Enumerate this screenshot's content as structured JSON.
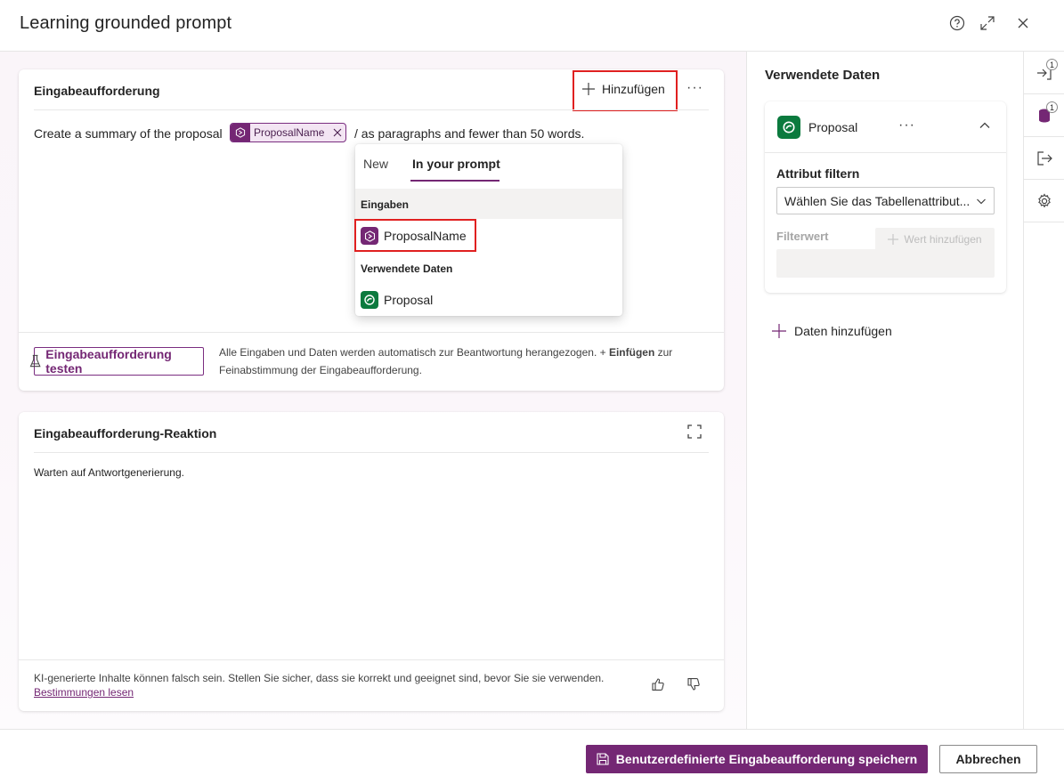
{
  "dialog": {
    "title": "Learning grounded prompt"
  },
  "prompt_card": {
    "title": "Eingabeaufforderung",
    "add_label": "Hinzufügen",
    "text_before": "Create a summary of the proposal",
    "chip_label": "ProposalName",
    "text_after": "/ as paragraphs and fewer than 50 words.",
    "test_button": "Eingabeaufforderung testen",
    "hint_part1": "Alle Eingaben und Daten werden automatisch zur Beantwortung herangezogen. + ",
    "hint_bold": "Einfügen",
    "hint_part2": " zur",
    "hint_line2": "Feinabstimmung der Eingabeaufforderung."
  },
  "insert_popup": {
    "tabs": [
      "New",
      "In your prompt"
    ],
    "active_tab": "In your prompt",
    "section_inputs": "Eingaben",
    "input_item": "ProposalName",
    "section_data": "Verwendete Daten",
    "data_item": "Proposal"
  },
  "response_card": {
    "title": "Eingabeaufforderung-Reaktion",
    "waiting_text": "Warten auf Antwortgenerierung.",
    "disclaimer": "KI-generierte Inhalte können falsch sein. Stellen Sie sicher, dass sie korrekt und geeignet sind, bevor Sie sie verwenden.",
    "terms_link": "Bestimmungen lesen"
  },
  "right_panel": {
    "title": "Verwendete Daten",
    "data_name": "Proposal",
    "filter_label": "Attribut filtern",
    "filter_placeholder": "Wählen Sie das Tabellenattribut...",
    "filter_value_label": "Filterwert",
    "add_value_button": "Wert hinzufügen",
    "add_data": "Daten hinzufügen"
  },
  "rail": {
    "inputs_badge": "1",
    "data_badge": "1"
  },
  "footer": {
    "save_label": "Benutzerdefinierte Eingabeaufforderung speichern",
    "cancel_label": "Abbrechen"
  },
  "colors": {
    "accent": "#742774",
    "highlight": "#e02020",
    "dataverse_green": "#0b7a3e"
  }
}
